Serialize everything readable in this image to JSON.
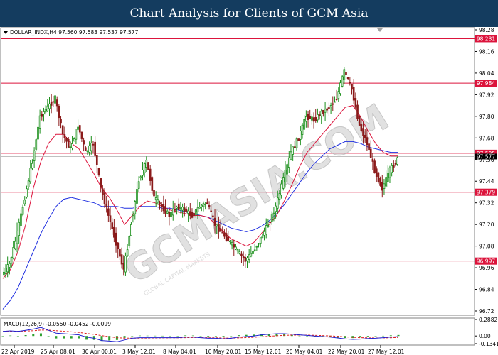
{
  "banner": {
    "title": "Chart Analysis for Clients of GCM Asia"
  },
  "colors": {
    "banner": "#143c5f",
    "bull": "#1a8f1a",
    "bear": "#8b1a1a",
    "ma_fast": "#dc143c",
    "ma_slow": "#2030e0",
    "level": "#dc143c",
    "macd_hist": "#2ea02e",
    "macd_signal": "#e02020",
    "macd_line": "#2020d0",
    "price_line": "#c0c0c0"
  },
  "watermark": {
    "text": "GCMASIA.COM",
    "subtext": "GLOBAL CAPITAL MARKETS"
  },
  "chart_data": [
    {
      "type": "candlestick",
      "symbol_header": "DOLLAR_INDX,H4  97.560 97.583 97.537 97.577",
      "x_ticks": [
        "22 Apr 2019",
        "25 Apr 08:01",
        "30 Apr 00:01",
        "3 May 12:01",
        "8 May 04:01",
        "10 May 20:01",
        "15 May 12:01",
        "20 May 04:01",
        "22 May 20:01",
        "27 May 12:01"
      ],
      "y_ticks": [
        98.28,
        98.16,
        98.04,
        97.92,
        97.8,
        97.68,
        97.56,
        97.44,
        97.32,
        97.2,
        97.08,
        96.96,
        96.84,
        96.72
      ],
      "ylim": [
        96.72,
        98.28
      ],
      "current_price": 97.577,
      "levels": [
        98.231,
        97.984,
        97.595,
        97.379,
        96.997
      ],
      "close_series": [
        96.92,
        96.98,
        97.15,
        97.35,
        97.55,
        97.8,
        97.85,
        97.9,
        97.7,
        97.62,
        97.75,
        97.6,
        97.65,
        97.4,
        97.25,
        97.1,
        96.95,
        97.2,
        97.45,
        97.55,
        97.35,
        97.3,
        97.25,
        97.3,
        97.28,
        97.25,
        97.3,
        97.32,
        97.2,
        97.15,
        97.1,
        97.05,
        97.0,
        97.05,
        97.12,
        97.2,
        97.3,
        97.45,
        97.6,
        97.68,
        97.8,
        97.78,
        97.82,
        97.85,
        97.9,
        98.05,
        97.95,
        97.75,
        97.65,
        97.5,
        97.4,
        97.5,
        97.56
      ],
      "ma_fast": [
        96.9,
        96.95,
        97.05,
        97.2,
        97.4,
        97.55,
        97.65,
        97.7,
        97.7,
        97.65,
        97.62,
        97.55,
        97.48,
        97.4,
        97.35,
        97.28,
        97.2,
        97.25,
        97.3,
        97.33,
        97.32,
        97.3,
        97.28,
        97.27,
        97.26,
        97.25,
        97.25,
        97.24,
        97.2,
        97.16,
        97.12,
        97.1,
        97.08,
        97.1,
        97.15,
        97.2,
        97.25,
        97.33,
        97.42,
        97.52,
        97.6,
        97.65,
        97.7,
        97.75,
        97.8,
        97.85,
        97.86,
        97.8,
        97.72,
        97.65,
        97.6,
        97.58,
        97.58
      ],
      "ma_slow": [
        96.73,
        96.78,
        96.85,
        96.95,
        97.05,
        97.15,
        97.23,
        97.3,
        97.34,
        97.35,
        97.34,
        97.33,
        97.32,
        97.3,
        97.3,
        97.3,
        97.29,
        97.29,
        97.3,
        97.3,
        97.3,
        97.29,
        97.29,
        97.28,
        97.27,
        97.26,
        97.25,
        97.24,
        97.22,
        97.2,
        97.18,
        97.17,
        97.16,
        97.17,
        97.19,
        97.22,
        97.26,
        97.31,
        97.37,
        97.43,
        97.49,
        97.54,
        97.58,
        97.62,
        97.64,
        97.66,
        97.66,
        97.65,
        97.63,
        97.62,
        97.61,
        97.6,
        97.6
      ]
    },
    {
      "type": "macd",
      "header": "MACD(12,26,9) -0.0550 -0.0452 -0.0099",
      "y_ticks": [
        0.2882,
        0.0,
        -0.1341
      ],
      "ylim": [
        -0.1341,
        0.2882
      ],
      "macd": [
        0.08,
        0.09,
        0.08,
        0.1,
        0.12,
        0.15,
        0.1,
        0.05,
        0.04,
        0.03,
        0.02,
        -0.02,
        -0.04,
        -0.08,
        -0.09,
        -0.1,
        -0.07,
        -0.04,
        -0.03,
        -0.03,
        -0.03,
        -0.03,
        -0.03,
        -0.03,
        -0.02,
        -0.02,
        -0.03,
        -0.04,
        -0.04,
        -0.05,
        -0.04,
        -0.02,
        -0.01,
        0.0,
        0.02,
        0.03,
        0.04,
        0.04,
        0.03,
        0.02,
        0.01,
        0.0,
        -0.01,
        -0.02,
        -0.035,
        -0.05,
        -0.06,
        -0.055,
        -0.045,
        -0.04,
        -0.03,
        -0.02,
        -0.01
      ]
    }
  ]
}
